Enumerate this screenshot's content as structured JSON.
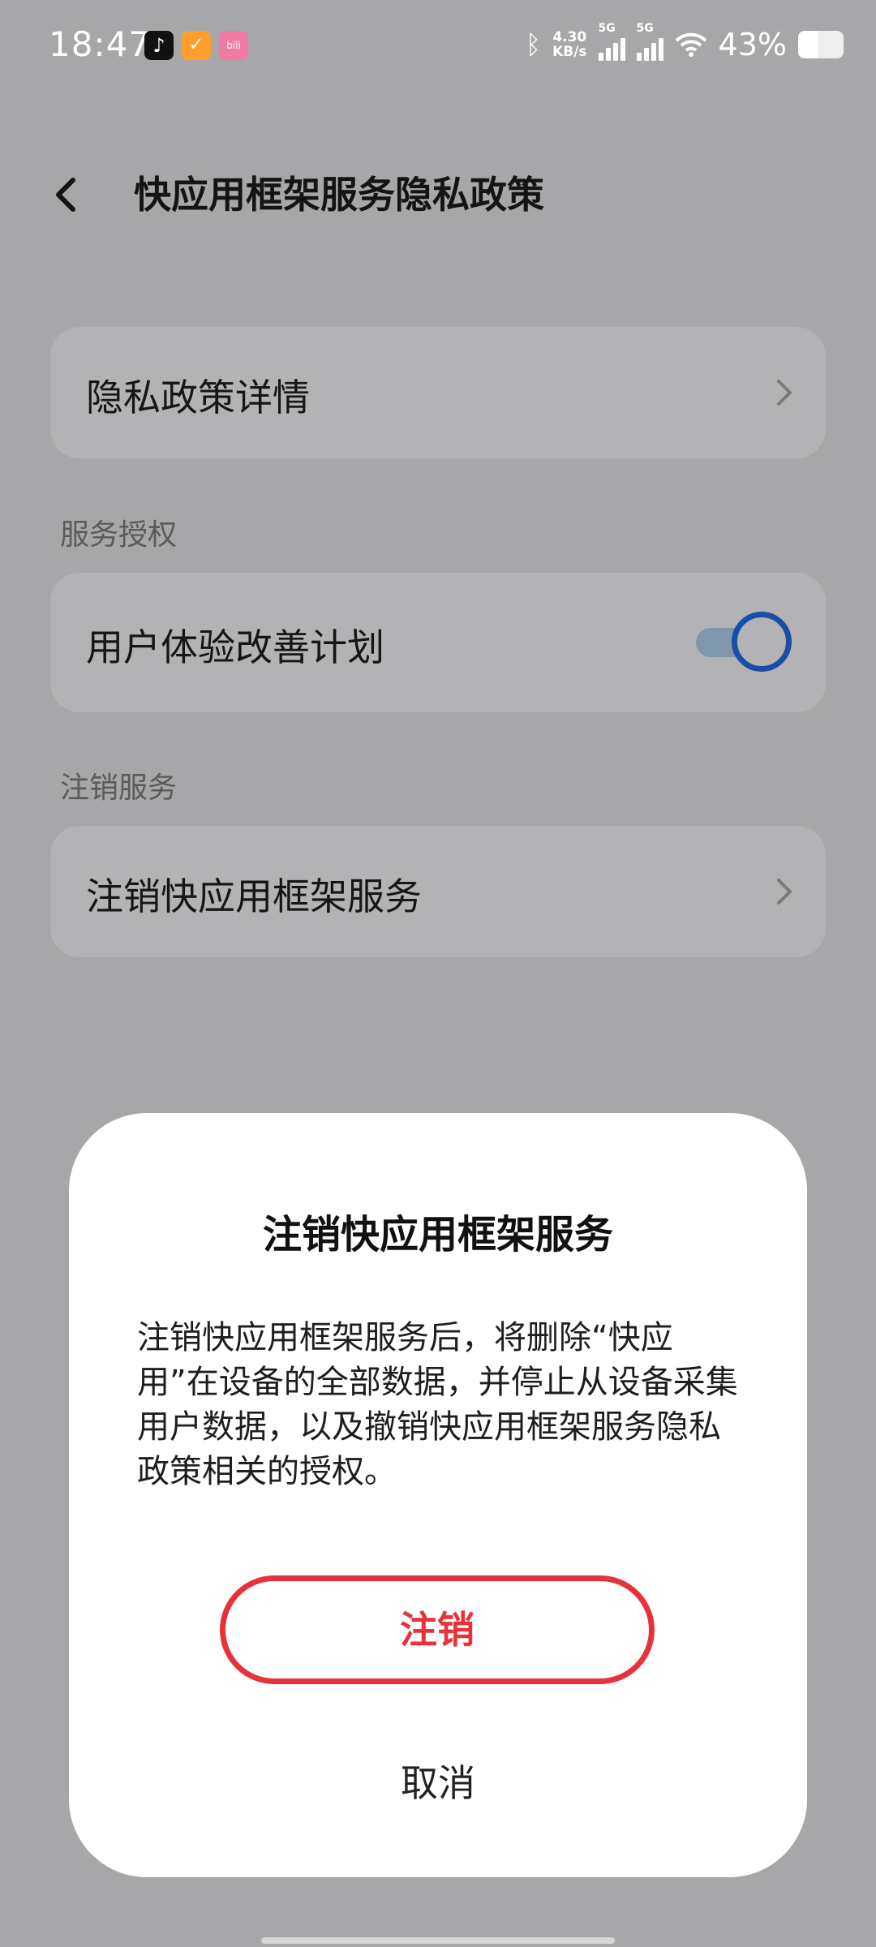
{
  "status_bar": {
    "time": "18:47",
    "net_speed_value": "4.30",
    "net_speed_unit": "KB/s",
    "sim1_label": "5G",
    "sim2_label": "5G",
    "battery_percent_text": "43%",
    "battery_level": 0.43,
    "icons": [
      "tiktok-icon",
      "orange-app-icon",
      "bilibili-icon",
      "bluetooth-icon",
      "signal-icon",
      "wifi-icon",
      "battery-icon"
    ]
  },
  "header": {
    "title": "快应用框架服务隐私政策"
  },
  "privacy_details": {
    "label": "隐私政策详情"
  },
  "service_auth": {
    "section_label": "服务授权",
    "ux_plan_label": "用户体验改善计划",
    "ux_plan_enabled": true
  },
  "deregister": {
    "section_label": "注销服务",
    "item_label": "注销快应用框架服务"
  },
  "dialog": {
    "title": "注销快应用框架服务",
    "body": "注销快应用框架服务后，将删除“快应用”在设备的全部数据，并停止从设备采集用户数据，以及撤销快应用框架服务隐私政策相关的授权。",
    "confirm_label": "注销",
    "cancel_label": "取消",
    "accent_color": "#e8323b"
  },
  "colors": {
    "overlay_background": "#a7a7a9",
    "toggle_accent": "#1a4ea6"
  }
}
